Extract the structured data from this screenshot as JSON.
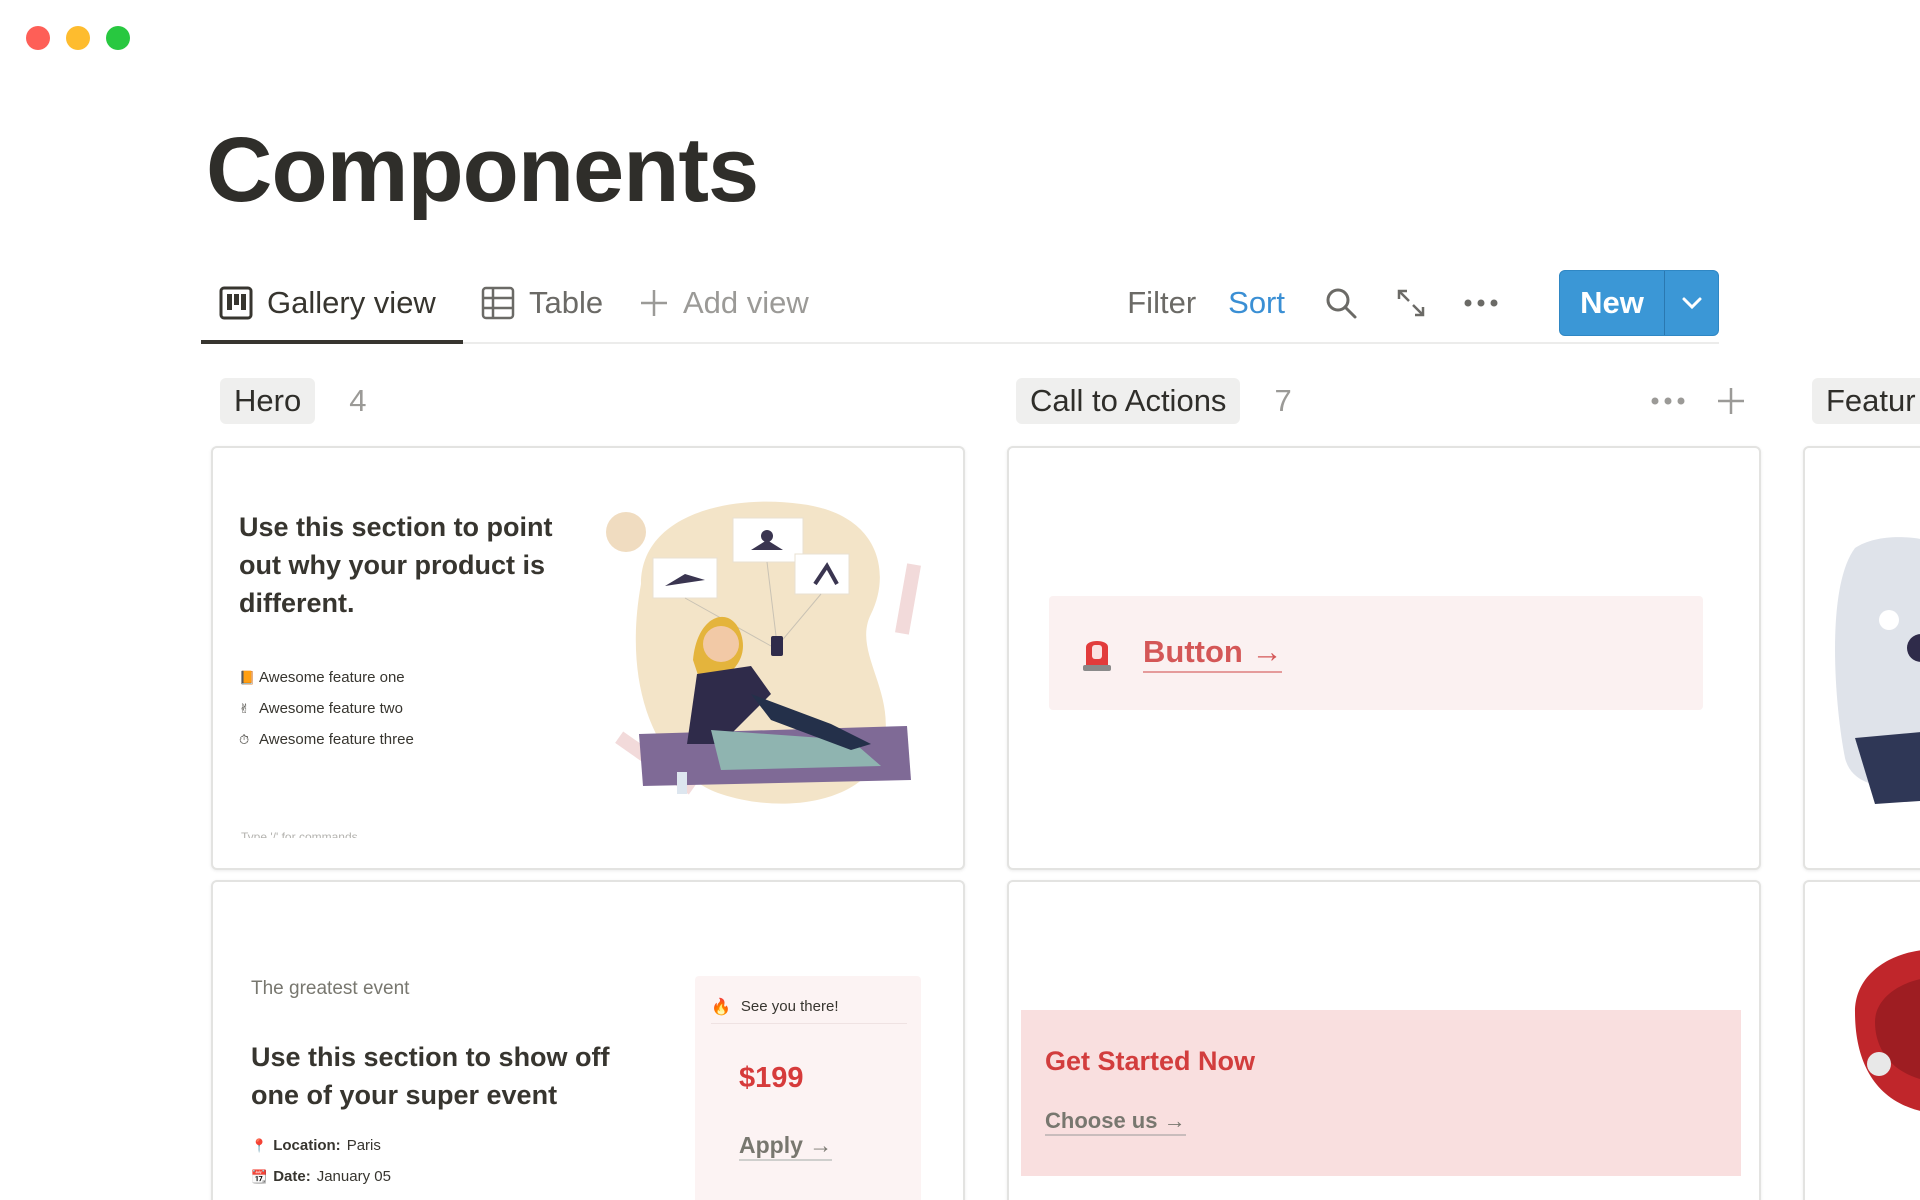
{
  "window": {
    "controls": [
      "close",
      "minimize",
      "zoom"
    ]
  },
  "page": {
    "title": "Components"
  },
  "views": {
    "tabs": [
      {
        "label": "Gallery view",
        "icon": "gallery-icon",
        "active": true
      },
      {
        "label": "Table",
        "icon": "table-icon",
        "active": false
      }
    ],
    "add_view": "Add view"
  },
  "toolbar": {
    "filter": "Filter",
    "sort": "Sort",
    "new": "New",
    "icons": [
      "search-icon",
      "expand-icon",
      "more-icon",
      "chevron-down-icon"
    ],
    "sort_color": "#3a8fd4",
    "new_color": "#3b97d6"
  },
  "groups": [
    {
      "name": "Hero",
      "count": "4"
    },
    {
      "name": "Call to Actions",
      "count": "7"
    },
    {
      "name": "Featur"
    }
  ],
  "cards": {
    "hero1": {
      "headline": "Use this section to point out why your product is different.",
      "features": [
        "Awesome feature one",
        "Awesome feature two",
        "Awesome feature three"
      ],
      "hint": "Type '/' for commands"
    },
    "cta1": {
      "button": "Button →"
    },
    "hero2": {
      "eyebrow": "The greatest event",
      "headline": "Use this section to show off one of your super event",
      "location_label": "Location:",
      "location": "Paris",
      "date_label": "Date:",
      "date": "January 05",
      "box_title": "See you there!",
      "price": "$199",
      "apply": "Apply →"
    },
    "cta2": {
      "title": "Get Started Now",
      "link": "Choose us →"
    }
  },
  "colors": {
    "accent_red": "#d63b3b",
    "callout_bg": "#fbf1f1",
    "cta_bg": "#f9dfdf"
  }
}
